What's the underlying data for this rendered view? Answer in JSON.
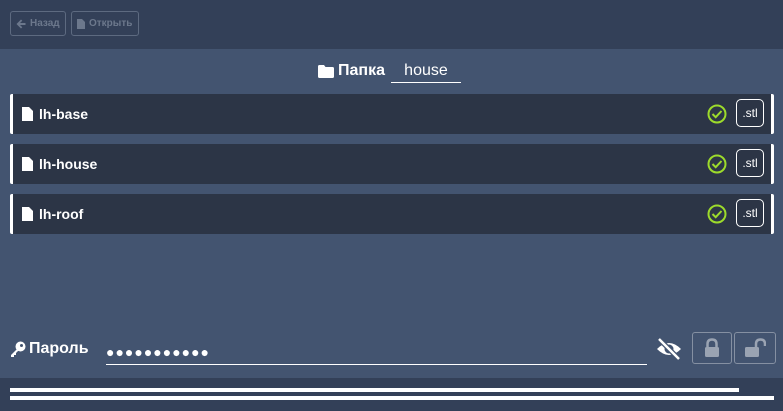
{
  "toolbar": {
    "back_label": "Назад",
    "open_label": "Открыть"
  },
  "folder": {
    "label": "Папка",
    "value": "house"
  },
  "files": [
    {
      "name": "lh-base",
      "status": "ok",
      "action_label": ".stl"
    },
    {
      "name": "lh-house",
      "status": "ok",
      "action_label": ".stl"
    },
    {
      "name": "lh-roof",
      "status": "ok",
      "action_label": ".stl"
    }
  ],
  "password": {
    "label": "Пароль",
    "value": "●●●●●●●●●●●"
  },
  "progress": {
    "bar1": 0.954,
    "bar2": 1.0
  },
  "colors": {
    "background": "#435470",
    "toolbar": "#334058",
    "row": "#2c3546",
    "check": "#9ddb2b",
    "text": "#ffffff"
  },
  "icons": {
    "back": "arrow-left-icon",
    "open": "file-icon",
    "folder": "folder-icon",
    "file": "file-icon",
    "status": "check-circle-icon",
    "key": "key-icon",
    "visibility": "eye-slash-icon",
    "lock": "lock-icon",
    "unlock": "unlock-icon"
  }
}
